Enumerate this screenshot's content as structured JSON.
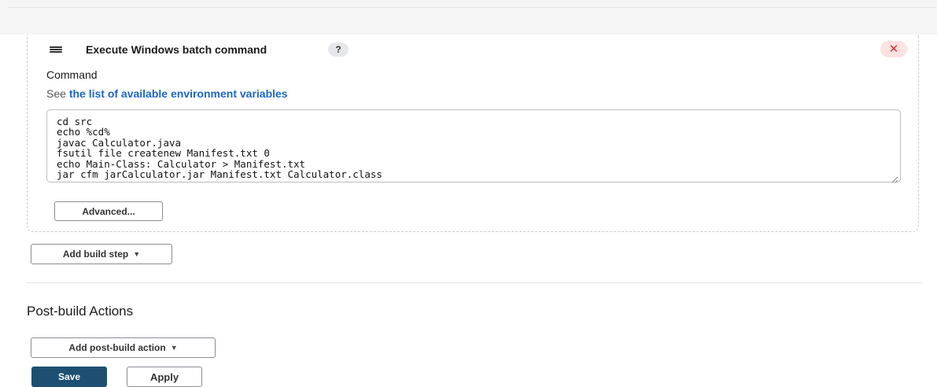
{
  "build_step": {
    "title": "Execute Windows batch command",
    "help_label": "?",
    "delete_label": "✕",
    "command_label": "Command",
    "env_prefix": "See ",
    "env_link": "the list of available environment variables",
    "command_text": "cd src\necho %cd%\njavac Calculator.java\nfsutil file createnew Manifest.txt 0\necho Main-Class: Calculator > Manifest.txt\njar cfm jarCalculator.jar Manifest.txt Calculator.class",
    "advanced_label": "Advanced..."
  },
  "add_build_step_label": "Add build step",
  "post_build": {
    "title": "Post-build Actions",
    "add_label": "Add post-build action"
  },
  "footer": {
    "save_label": "Save",
    "apply_label": "Apply"
  },
  "colors": {
    "link": "#1b66c9",
    "save_bg": "#1c4f72",
    "delete_bg": "#fde2e2",
    "delete_fg": "#d32f2f"
  }
}
